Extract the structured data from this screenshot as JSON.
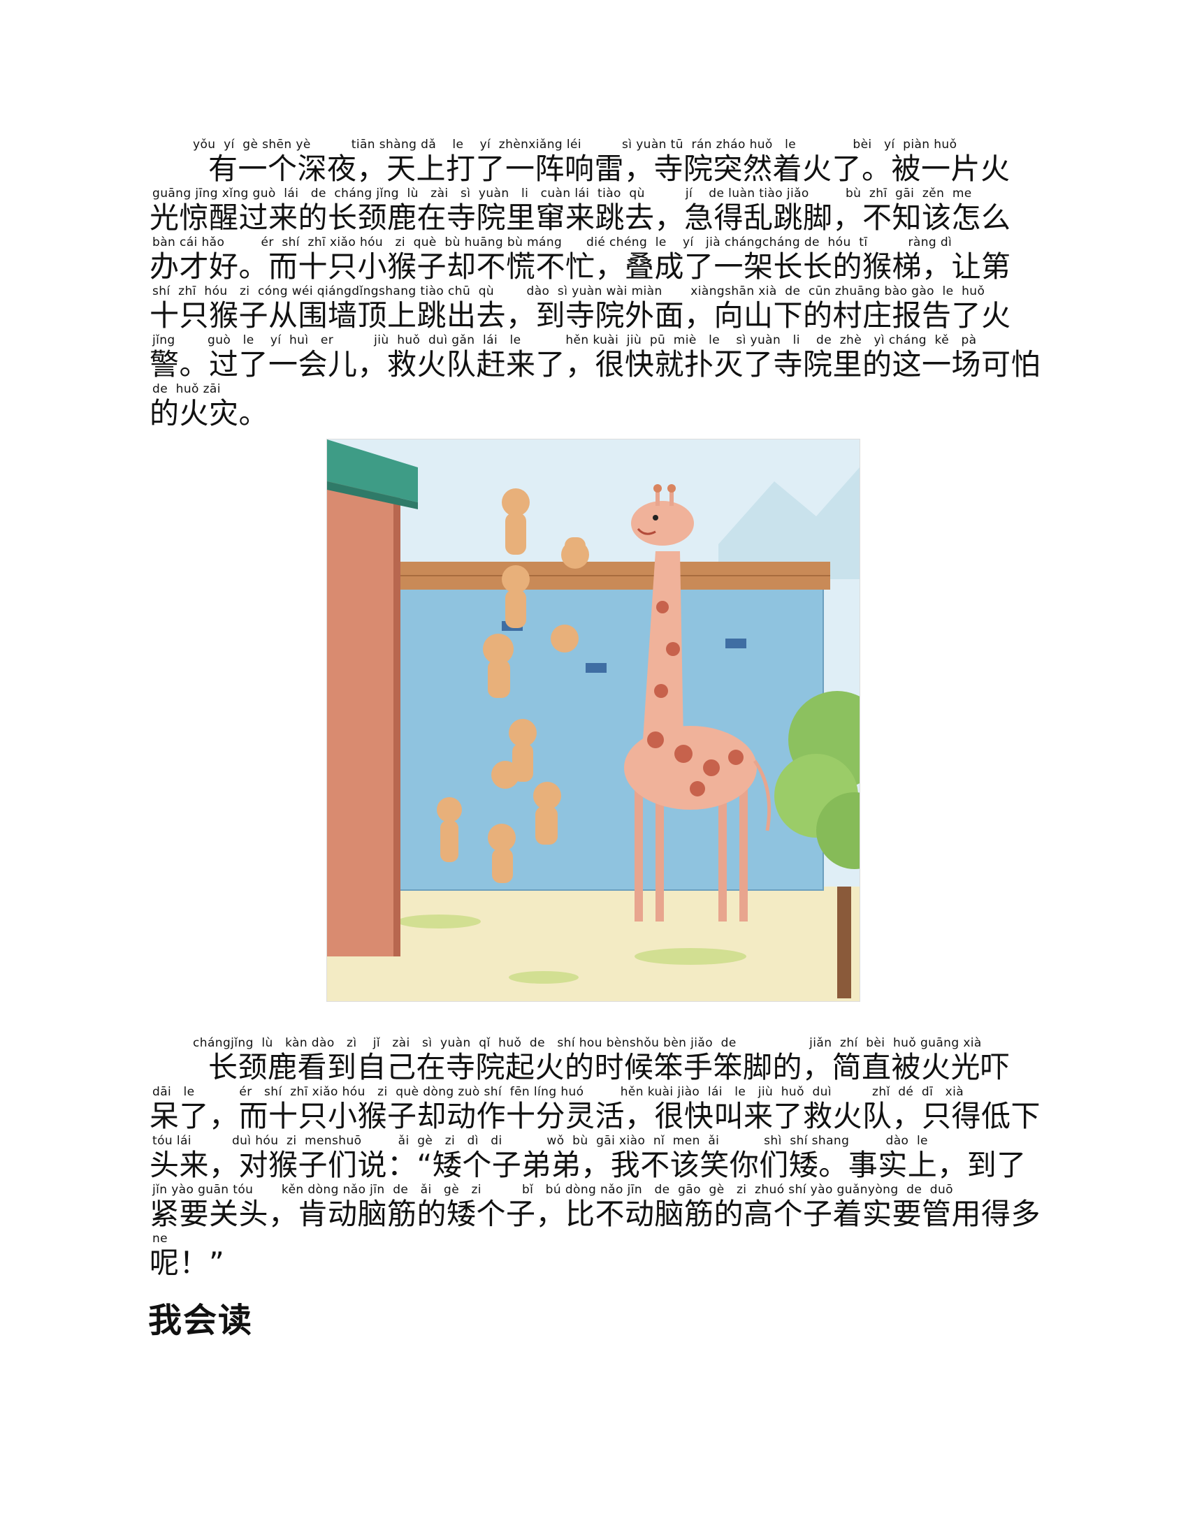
{
  "paragraph1": {
    "lines": [
      {
        "pinyin": "          yǒu  yí  gè shēn yè          tiān shàng dǎ    le    yí  zhènxiǎng léi          sì yuàn tū  rán zháo huǒ   le              bèi   yí  piàn huǒ",
        "text": "有一个深夜，天上打了一阵响雷，寺院突然着火了。被一片火"
      },
      {
        "pinyin": "guāng jīng xǐng guò  lái   de  cháng jǐng  lù   zài   sì  yuàn   li   cuàn lái  tiào  qù          jí    de luàn tiào jiǎo         bù  zhī  gāi  zěn  me",
        "text": "光惊醒过来的长颈鹿在寺院里窜来跳去，急得乱跳脚，不知该怎么"
      },
      {
        "pinyin": "bàn cái hǎo         ér  shí  zhī xiǎo hóu   zi  què  bù huāng bù máng      dié chéng  le    yí   jià chángcháng de  hóu  tī          ràng dì",
        "text": "办才好。而十只小猴子却不慌不忙，叠成了一架长长的猴梯，让第"
      },
      {
        "pinyin": "shí  zhī  hóu   zi  cóng wéi qiángdǐngshang tiào chū  qù        dào  sì yuàn wài miàn       xiàngshān xià  de  cūn zhuāng bào gào  le  huǒ",
        "text": "十只猴子从围墙顶上跳出去，到寺院外面，向山下的村庄报告了火"
      },
      {
        "pinyin": "jǐng        guò   le    yí  huì   er          jiù  huǒ  duì gǎn  lái   le           hěn kuài  jiù  pū  miè   le    sì yuàn   li    de  zhè   yì cháng  kě   pà",
        "text": "警。过了一会儿，救火队赶来了，很快就扑灭了寺院里的这一场可怕"
      },
      {
        "pinyin": "de  huǒ zāi",
        "text": "的火灾。"
      }
    ]
  },
  "paragraph2": {
    "lines": [
      {
        "pinyin": "          chángjǐng  lù   kàn dào   zì    jǐ   zài   sì  yuàn  qǐ  huǒ  de   shí hou bènshǒu bèn jiǎo  de                  jiǎn  zhí  bèi  huǒ guāng xià",
        "text": "长颈鹿看到自己在寺院起火的时候笨手笨脚的，简直被火光吓"
      },
      {
        "pinyin": "dāi   le           ér   shí  zhī xiǎo hóu   zi  què dòng zuò shí  fēn líng huó         hěn kuài jiào  lái   le   jiù  huǒ  duì          zhǐ  dé  dī   xià",
        "text": "呆了，而十只小猴子却动作十分灵活，很快叫来了救火队，只得低下"
      },
      {
        "pinyin": "tóu lái          duì hóu  zi  menshuō         ǎi  gè   zi   dì   di           wǒ  bù  gāi xiào  nǐ  men  ǎi           shì  shí shang         dào  le",
        "text": "头来，对猴子们说：“矮个子弟弟，我不该笑你们矮。事实上，到了"
      },
      {
        "pinyin": "jǐn yào guān tóu       kěn dòng nǎo jīn  de   ǎi   gè   zi          bǐ   bú dòng nǎo jīn   de  gāo  gè   zi  zhuó shí yào guǎnyòng  de  duō",
        "text": "紧要关头，肯动脑筋的矮个子，比不动脑筋的高个子着实要管用得多"
      },
      {
        "pinyin": "ne",
        "text": "呢！”"
      }
    ]
  },
  "heading": "我会读"
}
